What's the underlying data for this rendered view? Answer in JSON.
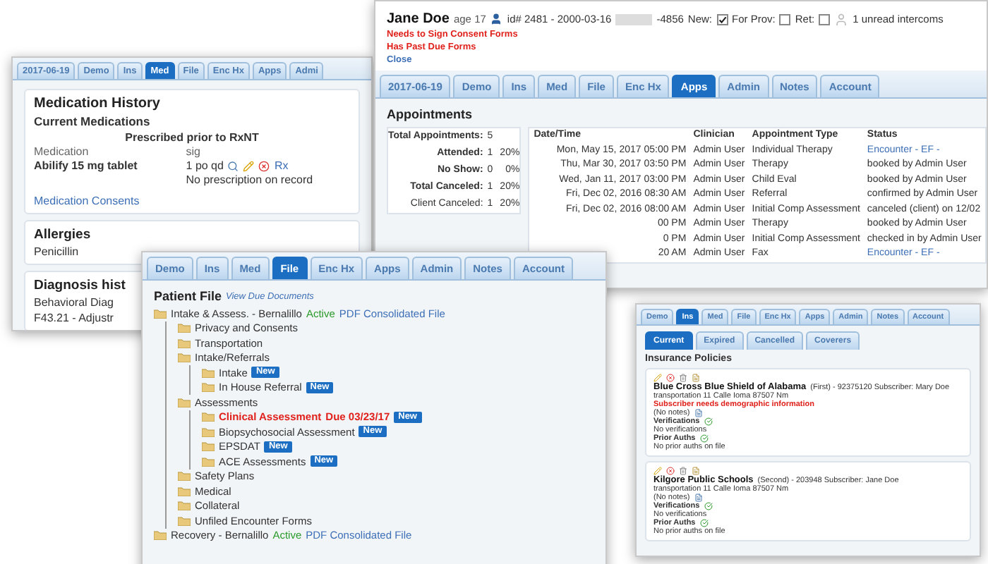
{
  "medication_window": {
    "tabs": [
      {
        "label": "2017-06-19",
        "selected": false
      },
      {
        "label": "Demo",
        "selected": false
      },
      {
        "label": "Ins",
        "selected": false
      },
      {
        "label": "Med",
        "selected": true
      },
      {
        "label": "File",
        "selected": false
      },
      {
        "label": "Enc Hx",
        "selected": false
      },
      {
        "label": "Apps",
        "selected": false
      },
      {
        "label": "Admi",
        "selected": false
      }
    ],
    "title": "Medication History",
    "subtitle": "Current Medications",
    "table_caption": "Prescribed prior to RxNT",
    "columns": [
      "Medication",
      "sig"
    ],
    "medication": {
      "name": "Abilify 15 mg tablet",
      "sig": "1 po qd",
      "rx": "Rx",
      "note": "No prescription on record"
    },
    "consents_link": "Medication Consents",
    "allergies": {
      "title": "Allergies",
      "value": "Penicillin"
    },
    "diagnosis": {
      "title": "Diagnosis hist",
      "lines": [
        "Behavioral Diag",
        "F43.21 - Adjustr"
      ]
    }
  },
  "appointments_window": {
    "patient": {
      "name": "Jane Doe",
      "age": "age 17",
      "id": "id# 2481 - 2000-03-16",
      "id_suffix": "-4856",
      "flags": [
        {
          "label": "New:",
          "checked": true
        },
        {
          "label": "For Prov:",
          "checked": false
        },
        {
          "label": "Ret:",
          "checked": false
        }
      ],
      "intercoms": "1 unread intercoms"
    },
    "alerts": [
      {
        "text": "Needs to Sign Consent Forms",
        "kind": "warning"
      },
      {
        "text": "Has Past Due Forms",
        "kind": "warning"
      },
      {
        "text": "Close",
        "kind": "link"
      }
    ],
    "tabs": [
      {
        "label": "2017-06-19",
        "selected": false
      },
      {
        "label": "Demo",
        "selected": false
      },
      {
        "label": "Ins",
        "selected": false
      },
      {
        "label": "Med",
        "selected": false
      },
      {
        "label": "File",
        "selected": false
      },
      {
        "label": "Enc Hx",
        "selected": false
      },
      {
        "label": "Apps",
        "selected": true
      },
      {
        "label": "Admin",
        "selected": false
      },
      {
        "label": "Notes",
        "selected": false
      },
      {
        "label": "Account",
        "selected": false
      }
    ],
    "title": "Appointments",
    "stats": [
      {
        "label": "Total Appointments:",
        "count": "5",
        "bold": true
      },
      {
        "label": "Attended:",
        "count": "1",
        "percent": "20%",
        "bold": true
      },
      {
        "label": "No Show:",
        "count": "0",
        "percent": "0%",
        "bold": true
      },
      {
        "label": "Total Canceled:",
        "count": "1",
        "percent": "20%",
        "bold": true
      },
      {
        "label": "Client Canceled:",
        "count": "1",
        "percent": "20%",
        "bold": false
      }
    ],
    "columns": [
      "Date/Time",
      "Clinician",
      "Appointment Type",
      "Status"
    ],
    "rows": [
      {
        "date": "Mon, May 15, 2017 05:00 PM",
        "clinician": "Admin User",
        "type": "Individual Therapy",
        "status": "Encounter - EF -",
        "kind": "link"
      },
      {
        "date": "Thu, Mar 30, 2017 03:50 PM",
        "clinician": "Admin User",
        "type": "Therapy",
        "status": "booked by Admin User",
        "kind": "text"
      },
      {
        "date": "Wed, Jan 11, 2017 03:00 PM",
        "clinician": "Admin User",
        "type": "Child Eval",
        "status": "booked by Admin User",
        "kind": "text"
      },
      {
        "date": "Fri, Dec 02, 2016 08:30 AM",
        "clinician": "Admin User",
        "type": "Referral",
        "status": "confirmed by Admin User",
        "kind": "text"
      },
      {
        "date": "Fri, Dec 02, 2016 08:00 AM",
        "clinician": "Admin User",
        "type": "Initial Comp Assessment",
        "status": "canceled (client) on 12/02",
        "kind": "text"
      },
      {
        "date": "00 PM",
        "clinician": "Admin User",
        "type": "Therapy",
        "status": "booked by Admin User",
        "kind": "text"
      },
      {
        "date": "0 PM",
        "clinician": "Admin User",
        "type": "Initial Comp Assessment",
        "status": "checked in by Admin User",
        "kind": "text"
      },
      {
        "date": "20 AM",
        "clinician": "Admin User",
        "type": "Fax",
        "status": "Encounter - EF -",
        "kind": "link"
      }
    ]
  },
  "file_window": {
    "tabs": [
      {
        "label": "Demo",
        "selected": false
      },
      {
        "label": "Ins",
        "selected": false
      },
      {
        "label": "Med",
        "selected": false
      },
      {
        "label": "File",
        "selected": true
      },
      {
        "label": "Enc Hx",
        "selected": false
      },
      {
        "label": "Apps",
        "selected": false
      },
      {
        "label": "Admin",
        "selected": false
      },
      {
        "label": "Notes",
        "selected": false
      },
      {
        "label": "Account",
        "selected": false
      }
    ],
    "title": "Patient File",
    "due_link": "View Due Documents",
    "tree": [
      {
        "label": "Intake & Assess. - Bernalillo",
        "status": "Active",
        "link": "PDF Consolidated File",
        "children": [
          {
            "label": "Privacy and Consents"
          },
          {
            "label": "Transportation"
          },
          {
            "label": "Intake/Referrals",
            "children": [
              {
                "label": "Intake",
                "badge": "New"
              },
              {
                "label": "In House Referral",
                "badge": "New"
              }
            ]
          },
          {
            "label": "Assessments",
            "children": [
              {
                "label": "Clinical Assessment",
                "overdue": true,
                "due": "Due 03/23/17",
                "badge": "New"
              },
              {
                "label": "Biopsychosocial Assessment",
                "badge": "New"
              },
              {
                "label": "EPSDAT",
                "badge": "New"
              },
              {
                "label": "ACE Assessments",
                "badge": "New"
              }
            ]
          },
          {
            "label": "Safety Plans"
          },
          {
            "label": "Medical"
          },
          {
            "label": "Collateral"
          },
          {
            "label": "Unfiled Encounter Forms"
          }
        ]
      },
      {
        "label": "Recovery - Bernalillo",
        "status": "Active",
        "link": "PDF Consolidated File"
      }
    ]
  },
  "insurance_window": {
    "tabs": [
      {
        "label": "Demo",
        "selected": false
      },
      {
        "label": "Ins",
        "selected": true
      },
      {
        "label": "Med",
        "selected": false
      },
      {
        "label": "File",
        "selected": false
      },
      {
        "label": "Enc Hx",
        "selected": false
      },
      {
        "label": "Apps",
        "selected": false
      },
      {
        "label": "Admin",
        "selected": false
      },
      {
        "label": "Notes",
        "selected": false
      },
      {
        "label": "Account",
        "selected": false
      }
    ],
    "subtabs": [
      {
        "label": "Current",
        "selected": true
      },
      {
        "label": "Expired",
        "selected": false
      },
      {
        "label": "Cancelled",
        "selected": false
      },
      {
        "label": "Coverers",
        "selected": false
      }
    ],
    "title": "Insurance Policies",
    "policies": [
      {
        "name": "Blue Cross Blue Shield of Alabama",
        "details": "(First) - 92375120 Subscriber: Mary Doe",
        "address": "transportation 11 Calle Ioma 87507 Nm",
        "warning": "Subscriber needs demographic information",
        "notes": "(No notes)",
        "verifications": "Verifications",
        "verifications_text": "No verifications",
        "prior_auths": "Prior Auths",
        "prior_auths_text": "No prior auths on file"
      },
      {
        "name": "Kilgore Public Schools",
        "details": "(Second) - 203948 Subscriber: Jane Doe",
        "address": "transportation 11 Calle Ioma 87507 Nm",
        "notes": "(No notes)",
        "verifications": "Verifications",
        "verifications_text": "No verifications",
        "prior_auths": "Prior Auths",
        "prior_auths_text": "No prior auths on file"
      }
    ]
  }
}
